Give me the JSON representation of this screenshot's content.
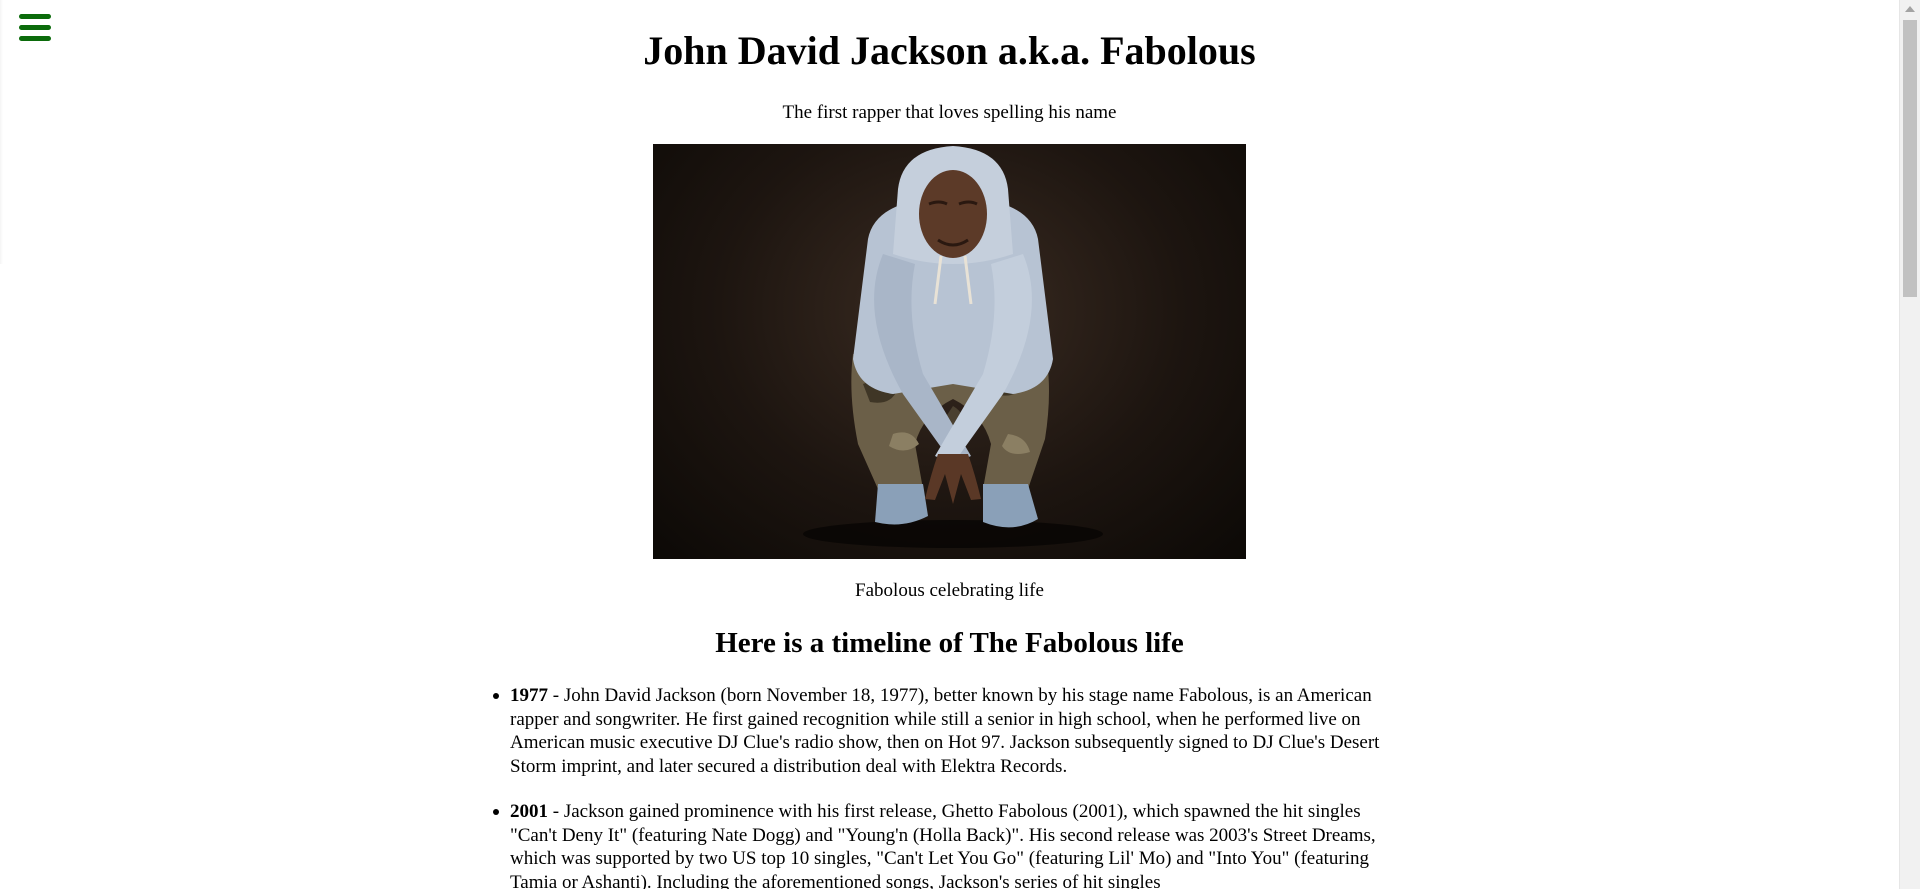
{
  "page": {
    "menu_icon": "hamburger-menu-icon",
    "title": "John David Jackson a.k.a. Fabolous",
    "tagline": "The first rapper that loves spelling his name",
    "image_caption": "Fabolous celebrating life",
    "timeline_heading": "Here is a timeline of The Fabolous life"
  },
  "timeline": [
    {
      "year": "1977",
      "text": " - John David Jackson (born November 18, 1977), better known by his stage name Fabolous, is an American rapper and songwriter. He first gained recognition while still a senior in high school, when he performed live on American music executive DJ Clue's radio show, then on Hot 97. Jackson subsequently signed to DJ Clue's Desert Storm imprint, and later secured a distribution deal with Elektra Records."
    },
    {
      "year": "2001",
      "text": " - Jackson gained prominence with his first release, Ghetto Fabolous (2001), which spawned the hit singles \"Can't Deny It\" (featuring Nate Dogg) and \"Young'n (Holla Back)\". His second release was 2003's Street Dreams, which was supported by two US top 10 singles, \"Can't Let You Go\" (featuring Lil' Mo) and \"Into You\" (featuring Tamia or Ashanti). Including the aforementioned songs, Jackson's series of hit singles"
    }
  ],
  "colors": {
    "menu_icon": "#0b6b0b",
    "text": "#000000",
    "background": "#ffffff"
  }
}
